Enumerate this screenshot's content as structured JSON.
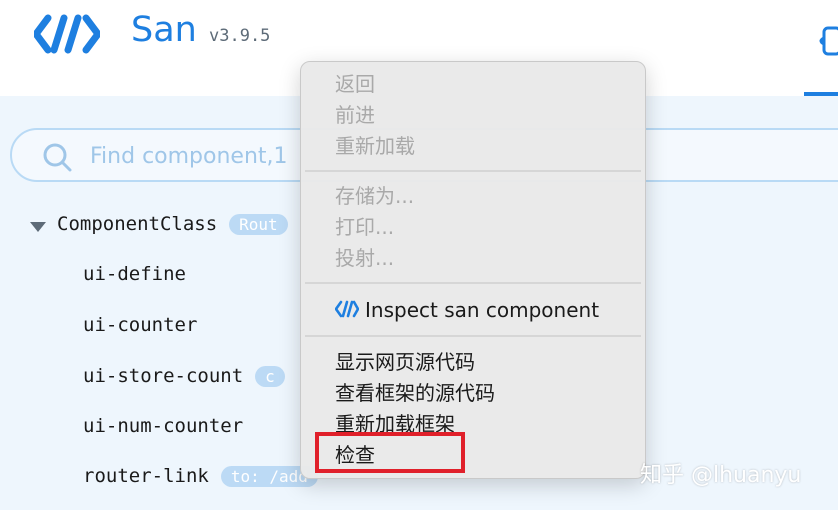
{
  "header": {
    "app_name": "San",
    "version": "v3.9.5",
    "brand_color": "#1e7fe0",
    "logo_icon": "san-logo-icon",
    "tab_icon": "components-tab-icon"
  },
  "search": {
    "placeholder": "Find component,1",
    "icon": "search-icon"
  },
  "tree": {
    "root": {
      "label": "ComponentClass",
      "badge": "Rout"
    },
    "children": [
      {
        "label": "ui-define"
      },
      {
        "label": "ui-counter"
      },
      {
        "label": "ui-store-count",
        "badge": "c"
      },
      {
        "label": "ui-num-counter"
      },
      {
        "label": "router-link",
        "badge": "to: /add"
      }
    ]
  },
  "context_menu": {
    "group1": [
      "返回",
      "前进",
      "重新加载"
    ],
    "group2": [
      "存储为...",
      "打印...",
      "投射..."
    ],
    "inspect_label": "Inspect san component",
    "group4": [
      "显示网页源代码",
      "查看框架的源代码",
      "重新加载框架",
      "检查"
    ]
  },
  "watermark": "知乎 @lhuanyu",
  "highlight_color": "#e0202a"
}
